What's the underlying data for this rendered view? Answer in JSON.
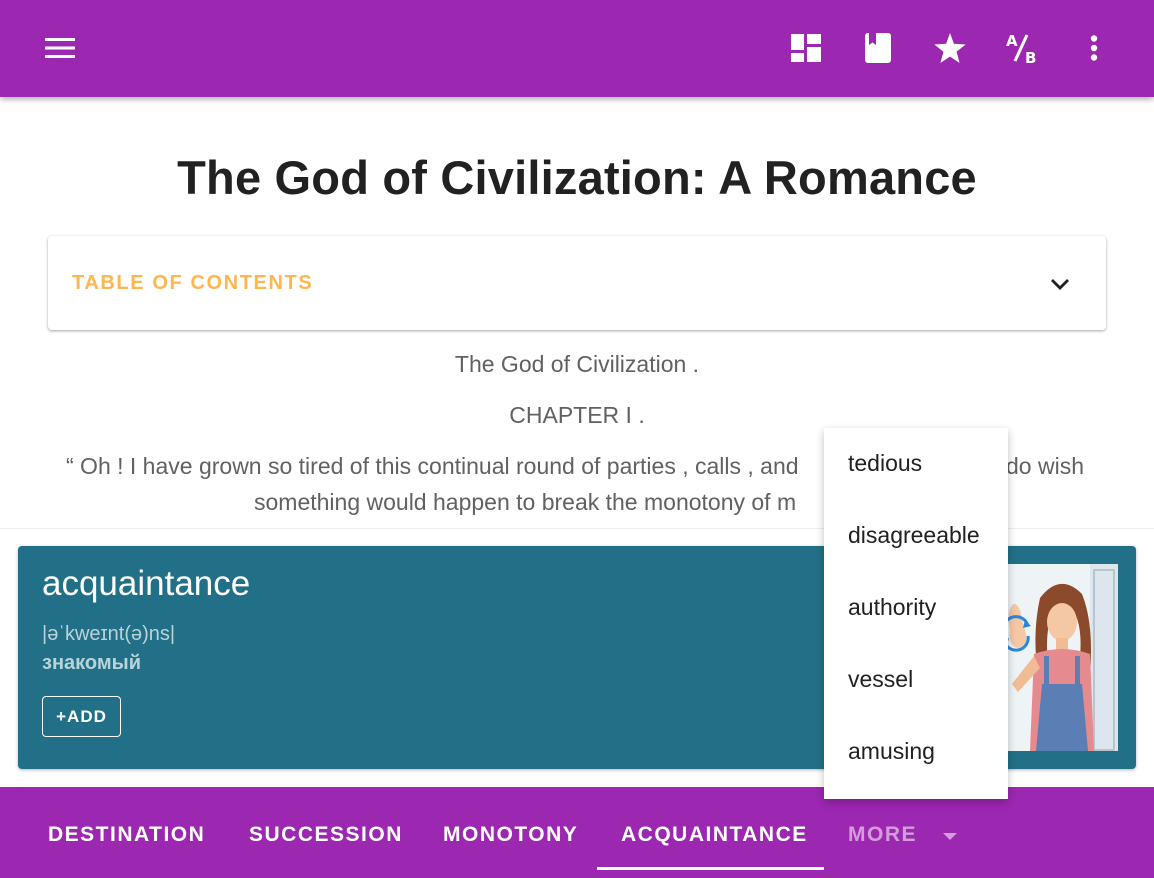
{
  "colors": {
    "primary": "#9c27b0",
    "card": "#217087",
    "toc_accent": "#ffb74d"
  },
  "appbar": {
    "menu_icon": "hamburger-menu-icon",
    "actions": [
      "dashboard-icon",
      "book-icon",
      "star-icon",
      "translate-ab-icon",
      "more-vert-icon"
    ]
  },
  "book": {
    "title": "The God of Civilization: A Romance",
    "toc_label": "TABLE OF CONTENTS",
    "lines": [
      "The God of Civilization .",
      "CHAPTER I .",
      "“ Oh ! I have grown so tired of this continual round of parties , calls , and",
      "do wish",
      "something would happen to break the monotony of m"
    ]
  },
  "word_card": {
    "word": "acquaintance",
    "ipa": "|əˈkweɪnt(ə)ns|",
    "translation": "знакомый",
    "add_label": "+ADD"
  },
  "dropdown": {
    "items": [
      "tedious",
      "disagreeable",
      "authority",
      "vessel",
      "amusing"
    ]
  },
  "tabs": {
    "items": [
      "DESTINATION",
      "SUCCESSION",
      "MONOTONY",
      "ACQUAINTANCE"
    ],
    "more_label": "MORE",
    "selected": "ACQUAINTANCE"
  }
}
